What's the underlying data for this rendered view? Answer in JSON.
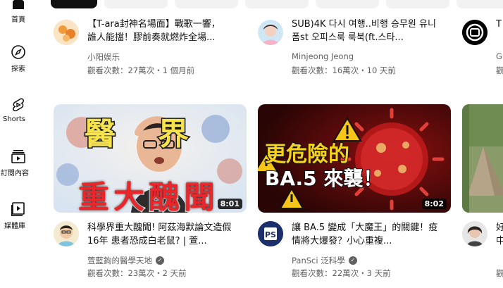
{
  "sidebar": {
    "items": [
      {
        "label": "首頁",
        "icon": "home-icon"
      },
      {
        "label": "探索",
        "icon": "compass-icon"
      },
      {
        "label": "Shorts",
        "icon": "shorts-icon"
      },
      {
        "label": "訂閱內容",
        "icon": "subscriptions-icon"
      },
      {
        "label": "媒體庫",
        "icon": "library-icon"
      }
    ]
  },
  "videos_row1": [
    {
      "title": "【T-ara封神名場面】戰歌一響，誰人能擋！膠前奏就燃炸全場...",
      "channel": "小阳娱乐",
      "meta": "觀看次數：27萬次・1 個月前"
    },
    {
      "title": "SUB)4K 다시 여행..비행 승무원 유니폼st 오피스룩 룩북(ft.스타...",
      "channel": "Minjeong Jeong",
      "meta": "觀看次數：16萬次・10 天前"
    },
    {
      "title": "T",
      "channel": "Gu",
      "meta": "觀"
    }
  ],
  "videos_row2": [
    {
      "title": "科學界重大醜聞! 阿茲海默論文造假16年 患者恐成白老鼠? | 萱...",
      "channel": "萱藍鉤的醫學天地",
      "meta": "觀看次數：23萬次・2 天前",
      "duration": "8:01",
      "thumb_text_top": [
        "醫",
        "界"
      ],
      "thumb_text_bottom": "重大醜聞",
      "verified": true
    },
    {
      "title": "讓 BA.5 變成「大魔王」的關鍵！疫情將大爆發？小心重複...",
      "channel": "PanSci 泛科學",
      "meta": "觀看次數：22萬次・3 天前",
      "duration": "8:02",
      "thumb_text_line1": "更危險的",
      "thumb_text_line2": "BA.5 來襲！",
      "verified": true
    },
    {
      "title": "好\n中",
      "channel": "",
      "meta": "觀"
    }
  ]
}
